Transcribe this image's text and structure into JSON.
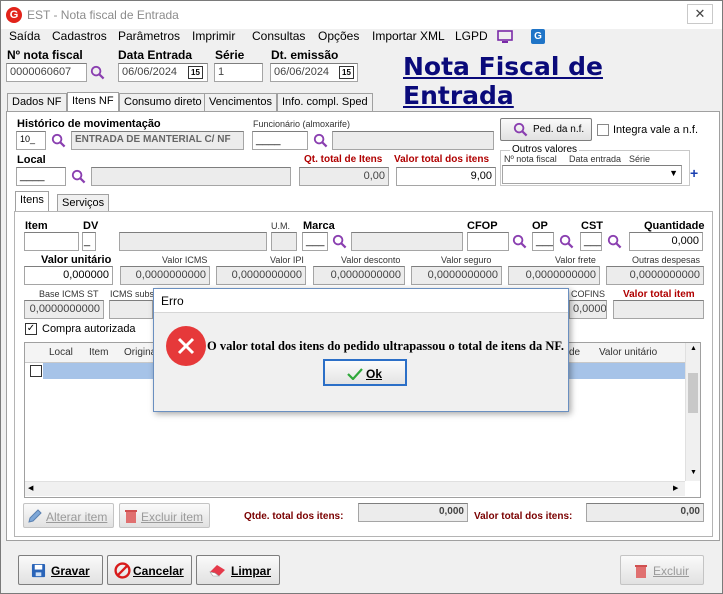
{
  "window": {
    "title": "EST - Nota fiscal de Entrada",
    "logo_letter": "G"
  },
  "menu": [
    "Saída",
    "Cadastros",
    "Parâmetros",
    "Imprimir",
    "Consultas",
    "Opções",
    "Importar XML",
    "LGPD"
  ],
  "header": {
    "nf_label": "Nº nota fiscal",
    "nf_value": "0000060607",
    "data_entrada_label": "Data Entrada",
    "data_entrada_value": "06/06/2024",
    "serie_label": "Série",
    "serie_value": "1",
    "dt_emissao_label": "Dt. emissão",
    "dt_emissao_value": "06/06/2024",
    "cal_label": "15",
    "big_title": "Nota Fiscal de Entrada"
  },
  "tabs": [
    "Dados NF",
    "Itens NF",
    "Consumo direto",
    "Vencimentos",
    "Info. compl. Sped"
  ],
  "itens_nf": {
    "historico_label": "Histórico de movimentação",
    "historico_code": "10_",
    "historico_desc": "ENTRADA DE MANTERIAL C/ NF",
    "funcionario_label": "Funcionário (almoxarife)",
    "funcionario_value": "____",
    "ped_button": "Ped. da n.f.",
    "integra_label": "Integra vale a n.f.",
    "local_label": "Local",
    "local_value": "____",
    "qt_total_label": "Qt. total de Itens",
    "qt_total_value": "0,00",
    "valor_total_label": "Valor total dos itens",
    "valor_total_value": "9,00",
    "outros_label": "Outros valores",
    "outros_cols": [
      "Nº nota fiscal",
      "Data entrada",
      "Série"
    ]
  },
  "subtabs": [
    "Itens",
    "Serviços"
  ],
  "item_form": {
    "item_label": "Item",
    "dv_label": "DV",
    "dv_value": "_",
    "um_label": "U.M.",
    "marca_label": "Marca",
    "marca_value": "___",
    "cfop_label": "CFOP",
    "op_label": "OP",
    "op_value": "___",
    "cst_label": "CST",
    "cst_value": "___",
    "quantidade_label": "Quantidade",
    "quantidade_value": "0,000",
    "row2": [
      {
        "label": "Valor unitário",
        "value": "0,000000"
      },
      {
        "label": "Valor ICMS",
        "value": "0,0000000000"
      },
      {
        "label": "Valor IPI",
        "value": "0,0000000000"
      },
      {
        "label": "Valor desconto",
        "value": "0,0000000000"
      },
      {
        "label": "Valor seguro",
        "value": "0,0000000000"
      },
      {
        "label": "Valor frete",
        "value": "0,0000000000"
      },
      {
        "label": "Outras despesas",
        "value": "0,0000000000"
      }
    ],
    "row3_left_labels": [
      "Base ICMS ST",
      "ICMS subs"
    ],
    "row3_left_value": "0,0000000000",
    "cofins_label": "COFINS",
    "cofins_value": "0,0000000000",
    "valor_total_item_label": "Valor total item",
    "compra_autorizada_label": "Compra autorizada"
  },
  "grid": {
    "headers": [
      "Local",
      "Item",
      "Origina",
      "de",
      "Valor unitário"
    ]
  },
  "footer_totals": {
    "alterar_item": "Alterar item",
    "excluir_item": "Excluir item",
    "qtde_total_label": "Qtde. total dos itens:",
    "qtde_total_value": "0,000",
    "valor_total_label": "Valor total dos itens:",
    "valor_total_value": "0,00"
  },
  "bottom_buttons": {
    "gravar": "Gravar",
    "cancelar": "Cancelar",
    "limpar": "Limpar",
    "excluir": "Excluir"
  },
  "dialog": {
    "title": "Erro",
    "message": "O valor total dos itens do pedido ultrapassou o total de itens da NF.",
    "ok": "Ok"
  },
  "colors": {
    "title_blue": "#0a0a7a",
    "red_label": "#b00000",
    "magnifier": "#8a3fb0",
    "error_red": "#e6393a",
    "selection": "#a6c3e8"
  }
}
